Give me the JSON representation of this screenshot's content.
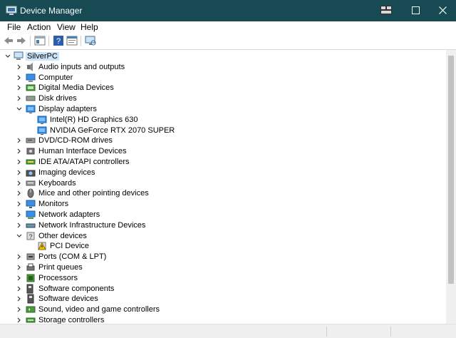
{
  "window": {
    "title": "Device Manager"
  },
  "menu": [
    "File",
    "Action",
    "View",
    "Help"
  ],
  "tree": {
    "root": "SilverPC",
    "items": [
      {
        "label": "Audio inputs and outputs",
        "icon": "speaker-icon",
        "state": "collapsed",
        "level": 1
      },
      {
        "label": "Computer",
        "icon": "computer-icon",
        "state": "collapsed",
        "level": 1
      },
      {
        "label": "Digital Media Devices",
        "icon": "media-device-icon",
        "state": "collapsed",
        "level": 1
      },
      {
        "label": "Disk drives",
        "icon": "disk-drive-icon",
        "state": "collapsed",
        "level": 1
      },
      {
        "label": "Display adapters",
        "icon": "display-adapter-icon",
        "state": "expanded",
        "level": 1
      },
      {
        "label": "Intel(R) HD Graphics 630",
        "icon": "display-adapter-icon",
        "state": "leaf",
        "level": 2
      },
      {
        "label": "NVIDIA GeForce RTX 2070 SUPER",
        "icon": "display-adapter-icon",
        "state": "leaf",
        "level": 2
      },
      {
        "label": "DVD/CD-ROM drives",
        "icon": "dvd-drive-icon",
        "state": "collapsed",
        "level": 1
      },
      {
        "label": "Human Interface Devices",
        "icon": "hid-icon",
        "state": "collapsed",
        "level": 1
      },
      {
        "label": "IDE ATA/ATAPI controllers",
        "icon": "ide-controller-icon",
        "state": "collapsed",
        "level": 1
      },
      {
        "label": "Imaging devices",
        "icon": "camera-icon",
        "state": "collapsed",
        "level": 1
      },
      {
        "label": "Keyboards",
        "icon": "keyboard-icon",
        "state": "collapsed",
        "level": 1
      },
      {
        "label": "Mice and other pointing devices",
        "icon": "mouse-icon",
        "state": "collapsed",
        "level": 1
      },
      {
        "label": "Monitors",
        "icon": "monitor-icon",
        "state": "collapsed",
        "level": 1
      },
      {
        "label": "Network adapters",
        "icon": "network-adapter-icon",
        "state": "collapsed",
        "level": 1
      },
      {
        "label": "Network Infrastructure Devices",
        "icon": "network-infrastructure-icon",
        "state": "collapsed",
        "level": 1
      },
      {
        "label": "Other devices",
        "icon": "unknown-device-icon",
        "state": "expanded",
        "level": 1
      },
      {
        "label": "PCI Device",
        "icon": "warning-device-icon",
        "state": "leaf",
        "level": 2
      },
      {
        "label": "Ports (COM & LPT)",
        "icon": "port-icon",
        "state": "collapsed",
        "level": 1
      },
      {
        "label": "Print queues",
        "icon": "printer-icon",
        "state": "collapsed",
        "level": 1
      },
      {
        "label": "Processors",
        "icon": "processor-icon",
        "state": "collapsed",
        "level": 1
      },
      {
        "label": "Software components",
        "icon": "software-component-icon",
        "state": "collapsed",
        "level": 1
      },
      {
        "label": "Software devices",
        "icon": "software-device-icon",
        "state": "collapsed",
        "level": 1
      },
      {
        "label": "Sound, video and game controllers",
        "icon": "sound-controller-icon",
        "state": "collapsed",
        "level": 1
      },
      {
        "label": "Storage controllers",
        "icon": "storage-controller-icon",
        "state": "collapsed",
        "level": 1
      }
    ]
  },
  "colors": {
    "titlebar": "#174a52",
    "selection": "#cce4f7",
    "accent": "#1e7bd6"
  }
}
